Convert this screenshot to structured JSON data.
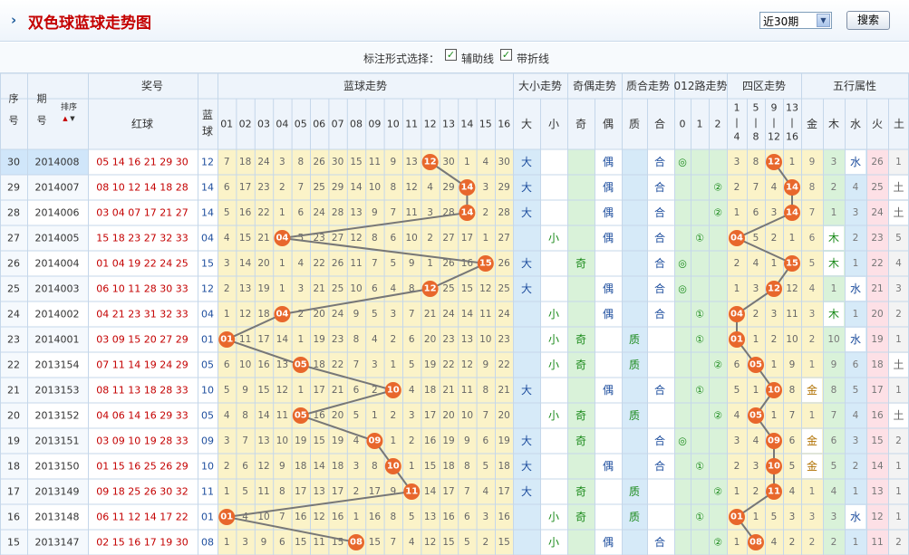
{
  "title": "双色球蓝球走势图",
  "period_select": {
    "value": "近30期"
  },
  "search_label": "搜索",
  "options": {
    "label": "标注形式选择：",
    "aux_line": "辅助线",
    "fold_line": "带折线"
  },
  "headers": {
    "seq": [
      "序",
      "号"
    ],
    "issue": [
      "期",
      "号"
    ],
    "sort": "排序",
    "prize": "奖号",
    "red": "红球",
    "blue": [
      "蓝",
      "球"
    ],
    "blue_trend": "蓝球走势",
    "size_trend": "大小走势",
    "parity_trend": "奇偶走势",
    "prime_trend": "质合走势",
    "route_trend": "012路走势",
    "zone_trend": "四区走势",
    "element_trend": "五行属性",
    "blue_numbers": [
      "01",
      "02",
      "03",
      "04",
      "05",
      "06",
      "07",
      "08",
      "09",
      "10",
      "11",
      "12",
      "13",
      "14",
      "15",
      "16"
    ],
    "size_cols": [
      "大",
      "小"
    ],
    "parity_cols": [
      "奇",
      "偶"
    ],
    "prime_cols": [
      "质",
      "合"
    ],
    "route_cols": [
      "0",
      "1",
      "2"
    ],
    "zone_cols": [
      [
        "1",
        "|",
        "4"
      ],
      [
        "5",
        "|",
        "8"
      ],
      [
        "9",
        "|",
        "12"
      ],
      [
        "13",
        "|",
        "16"
      ]
    ],
    "element_cols": [
      "金",
      "木",
      "水",
      "火",
      "土"
    ]
  },
  "rows": [
    {
      "seq": "30",
      "issue": "2014008",
      "red": "05 14 16 21 29 30",
      "blue": "12",
      "miss": [
        "7",
        "18",
        "24",
        "3",
        "8",
        "26",
        "30",
        "15",
        "11",
        "9",
        "13",
        "12",
        "30",
        "1",
        "4",
        "30"
      ],
      "size": "大",
      "parity": "偶",
      "prime": "合",
      "route": "◎",
      "zone": [
        "3",
        "8",
        "12",
        "1"
      ],
      "element": [
        "9",
        "3",
        "水",
        "26",
        "1"
      ]
    },
    {
      "seq": "29",
      "issue": "2014007",
      "red": "08 10 12 14 18 28",
      "blue": "14",
      "miss": [
        "6",
        "17",
        "23",
        "2",
        "7",
        "25",
        "29",
        "14",
        "10",
        "8",
        "12",
        "4",
        "29",
        "14",
        "3",
        "29"
      ],
      "size": "大",
      "parity": "偶",
      "prime": "合",
      "route": "②",
      "zone": [
        "2",
        "7",
        "4",
        "14"
      ],
      "element": [
        "8",
        "2",
        "4",
        "25",
        "土"
      ]
    },
    {
      "seq": "28",
      "issue": "2014006",
      "red": "03 04 07 17 21 27",
      "blue": "14",
      "miss": [
        "5",
        "16",
        "22",
        "1",
        "6",
        "24",
        "28",
        "13",
        "9",
        "7",
        "11",
        "3",
        "28",
        "14",
        "2",
        "28"
      ],
      "size": "大",
      "parity": "偶",
      "prime": "合",
      "route": "②",
      "zone": [
        "1",
        "6",
        "3",
        "14"
      ],
      "element": [
        "7",
        "1",
        "3",
        "24",
        "土"
      ]
    },
    {
      "seq": "27",
      "issue": "2014005",
      "red": "15 18 23 27 32 33",
      "blue": "04",
      "miss": [
        "4",
        "15",
        "21",
        "04",
        "5",
        "23",
        "27",
        "12",
        "8",
        "6",
        "10",
        "2",
        "27",
        "17",
        "1",
        "27"
      ],
      "size": "小",
      "parity": "偶",
      "prime": "合",
      "route": "①",
      "zone": [
        "04",
        "5",
        "2",
        "1"
      ],
      "element": [
        "6",
        "木",
        "2",
        "23",
        "5"
      ]
    },
    {
      "seq": "26",
      "issue": "2014004",
      "red": "01 04 19 22 24 25",
      "blue": "15",
      "miss": [
        "3",
        "14",
        "20",
        "1",
        "4",
        "22",
        "26",
        "11",
        "7",
        "5",
        "9",
        "1",
        "26",
        "16",
        "15",
        "26"
      ],
      "size": "大",
      "parity": "奇",
      "prime": "合",
      "route": "◎",
      "zone": [
        "2",
        "4",
        "1",
        "15"
      ],
      "element": [
        "5",
        "木",
        "1",
        "22",
        "4"
      ]
    },
    {
      "seq": "25",
      "issue": "2014003",
      "red": "06 10 11 28 30 33",
      "blue": "12",
      "miss": [
        "2",
        "13",
        "19",
        "1",
        "3",
        "21",
        "25",
        "10",
        "6",
        "4",
        "8",
        "12",
        "25",
        "15",
        "12",
        "25"
      ],
      "size": "大",
      "parity": "偶",
      "prime": "合",
      "route": "◎",
      "zone": [
        "1",
        "3",
        "12",
        "12"
      ],
      "element": [
        "4",
        "1",
        "水",
        "21",
        "3"
      ]
    },
    {
      "seq": "24",
      "issue": "2014002",
      "red": "04 21 23 31 32 33",
      "blue": "04",
      "miss": [
        "1",
        "12",
        "18",
        "04",
        "2",
        "20",
        "24",
        "9",
        "5",
        "3",
        "7",
        "21",
        "24",
        "14",
        "11",
        "24"
      ],
      "size": "小",
      "parity": "偶",
      "prime": "合",
      "route": "①",
      "zone": [
        "04",
        "2",
        "3",
        "11"
      ],
      "element": [
        "3",
        "木",
        "1",
        "20",
        "2"
      ]
    },
    {
      "seq": "23",
      "issue": "2014001",
      "red": "03 09 15 20 27 29",
      "blue": "01",
      "miss": [
        "01",
        "11",
        "17",
        "14",
        "1",
        "19",
        "23",
        "8",
        "4",
        "2",
        "6",
        "20",
        "23",
        "13",
        "10",
        "23"
      ],
      "size": "小",
      "parity": "奇",
      "prime": "质",
      "route": "①",
      "zone": [
        "01",
        "1",
        "2",
        "10"
      ],
      "element": [
        "2",
        "10",
        "水",
        "19",
        "1"
      ]
    },
    {
      "seq": "22",
      "issue": "2013154",
      "red": "07 11 14 19 24 29",
      "blue": "05",
      "miss": [
        "6",
        "10",
        "16",
        "13",
        "05",
        "18",
        "22",
        "7",
        "3",
        "1",
        "5",
        "19",
        "22",
        "12",
        "9",
        "22"
      ],
      "size": "小",
      "parity": "奇",
      "prime": "质",
      "route": "②",
      "zone": [
        "6",
        "05",
        "1",
        "9"
      ],
      "element": [
        "1",
        "9",
        "6",
        "18",
        "土"
      ]
    },
    {
      "seq": "21",
      "issue": "2013153",
      "red": "08 11 13 18 28 33",
      "blue": "10",
      "miss": [
        "5",
        "9",
        "15",
        "12",
        "1",
        "17",
        "21",
        "6",
        "2",
        "10",
        "4",
        "18",
        "21",
        "11",
        "8",
        "21"
      ],
      "size": "大",
      "parity": "偶",
      "prime": "合",
      "route": "①",
      "zone": [
        "5",
        "1",
        "10",
        "8"
      ],
      "element": [
        "金",
        "8",
        "5",
        "17",
        "1"
      ]
    },
    {
      "seq": "20",
      "issue": "2013152",
      "red": "04 06 14 16 29 33",
      "blue": "05",
      "miss": [
        "4",
        "8",
        "14",
        "11",
        "05",
        "16",
        "20",
        "5",
        "1",
        "2",
        "3",
        "17",
        "20",
        "10",
        "7",
        "20"
      ],
      "size": "小",
      "parity": "奇",
      "prime": "质",
      "route": "②",
      "zone": [
        "4",
        "05",
        "1",
        "7"
      ],
      "element": [
        "1",
        "7",
        "4",
        "16",
        "土"
      ]
    },
    {
      "seq": "19",
      "issue": "2013151",
      "red": "03 09 10 19 28 33",
      "blue": "09",
      "miss": [
        "3",
        "7",
        "13",
        "10",
        "19",
        "15",
        "19",
        "4",
        "09",
        "1",
        "2",
        "16",
        "19",
        "9",
        "6",
        "19"
      ],
      "size": "大",
      "parity": "奇",
      "prime": "合",
      "route": "◎",
      "zone": [
        "3",
        "4",
        "09",
        "6"
      ],
      "element": [
        "金",
        "6",
        "3",
        "15",
        "2"
      ]
    },
    {
      "seq": "18",
      "issue": "2013150",
      "red": "01 15 16 25 26 29",
      "blue": "10",
      "miss": [
        "2",
        "6",
        "12",
        "9",
        "18",
        "14",
        "18",
        "3",
        "8",
        "10",
        "1",
        "15",
        "18",
        "8",
        "5",
        "18"
      ],
      "size": "大",
      "parity": "偶",
      "prime": "合",
      "route": "①",
      "zone": [
        "2",
        "3",
        "10",
        "5"
      ],
      "element": [
        "金",
        "5",
        "2",
        "14",
        "1"
      ]
    },
    {
      "seq": "17",
      "issue": "2013149",
      "red": "09 18 25 26 30 32",
      "blue": "11",
      "miss": [
        "1",
        "5",
        "11",
        "8",
        "17",
        "13",
        "17",
        "2",
        "17",
        "9",
        "11",
        "14",
        "17",
        "7",
        "4",
        "17"
      ],
      "size": "大",
      "parity": "奇",
      "prime": "质",
      "route": "②",
      "zone": [
        "1",
        "2",
        "11",
        "4"
      ],
      "element": [
        "1",
        "4",
        "1",
        "13",
        "1"
      ]
    },
    {
      "seq": "16",
      "issue": "2013148",
      "red": "06 11 12 14 17 22",
      "blue": "01",
      "miss": [
        "01",
        "4",
        "10",
        "7",
        "16",
        "12",
        "16",
        "1",
        "16",
        "8",
        "5",
        "13",
        "16",
        "6",
        "3",
        "16"
      ],
      "size": "小",
      "parity": "奇",
      "prime": "质",
      "route": "①",
      "zone": [
        "01",
        "1",
        "5",
        "3"
      ],
      "element": [
        "3",
        "3",
        "水",
        "12",
        "1"
      ]
    },
    {
      "seq": "15",
      "issue": "2013147",
      "red": "02 15 16 17 19 30",
      "blue": "08",
      "miss": [
        "1",
        "3",
        "9",
        "6",
        "15",
        "11",
        "15",
        "08",
        "15",
        "7",
        "4",
        "12",
        "15",
        "5",
        "2",
        "15"
      ],
      "size": "小",
      "parity": "偶",
      "prime": "合",
      "route": "②",
      "zone": [
        "1",
        "08",
        "4",
        "2"
      ],
      "element": [
        "2",
        "2",
        "1",
        "11",
        "2"
      ]
    }
  ],
  "colors": {
    "hit": "#e8672c",
    "line": "#777777",
    "title": "#c40000",
    "issue_bg": "#d0e6fa",
    "blue_text": "#1e4e9e",
    "red_text": "#c40000"
  }
}
